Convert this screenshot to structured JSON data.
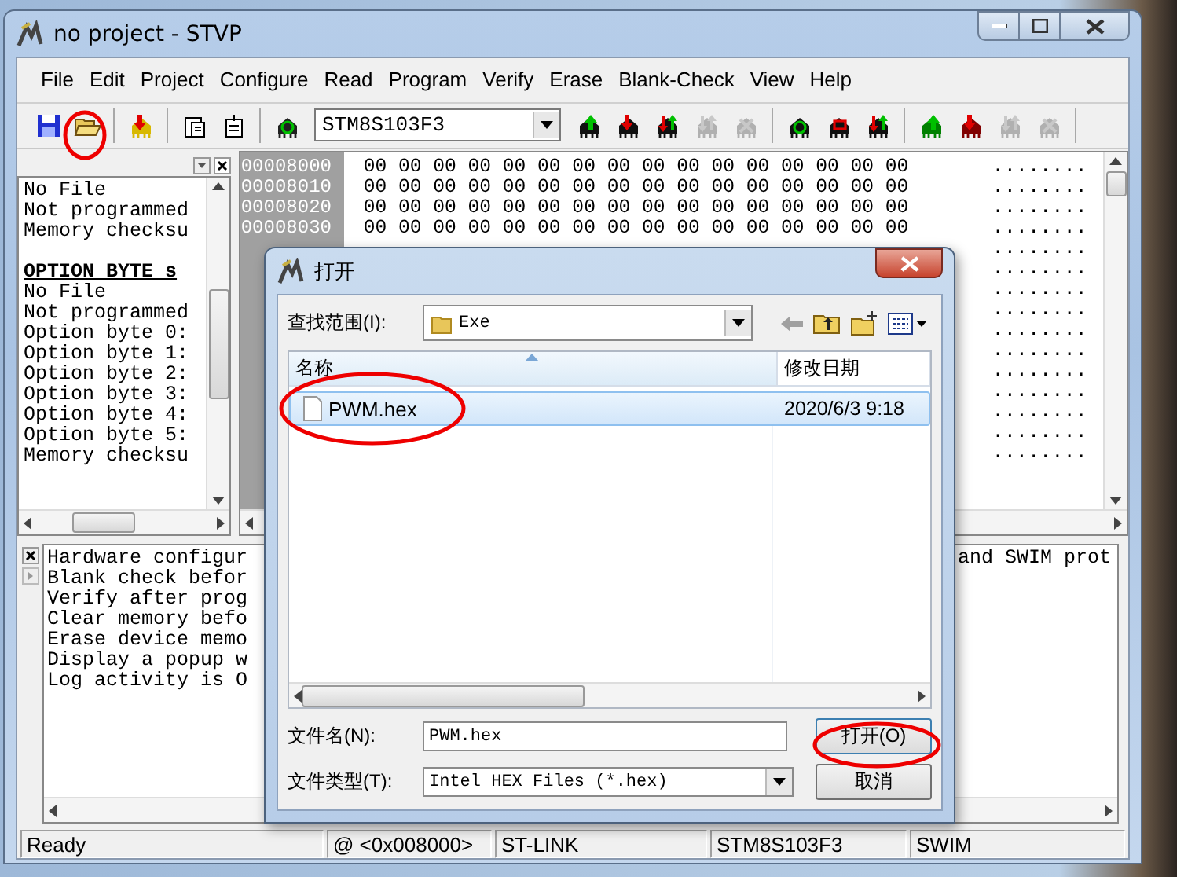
{
  "window": {
    "title": "no project - STVP"
  },
  "menu": [
    {
      "label": "File"
    },
    {
      "label": "Edit"
    },
    {
      "label": "Project"
    },
    {
      "label": "Configure"
    },
    {
      "label": "Read"
    },
    {
      "label": "Program"
    },
    {
      "label": "Verify"
    },
    {
      "label": "Erase"
    },
    {
      "label": "Blank-Check"
    },
    {
      "label": "View"
    },
    {
      "label": "Help"
    }
  ],
  "toolbar": {
    "device": "STM8S103F3",
    "chip_groups": [
      [
        {
          "kind": "up",
          "disabled": false
        },
        {
          "kind": "down",
          "disabled": false
        },
        {
          "kind": "both",
          "disabled": false
        },
        {
          "kind": "both",
          "disabled": true
        },
        {
          "kind": "cross",
          "disabled": true
        }
      ],
      [
        {
          "kind": "circle",
          "disabled": false
        },
        {
          "kind": "square",
          "disabled": false
        },
        {
          "kind": "both",
          "disabled": false
        }
      ],
      [
        {
          "kind": "up",
          "disabled": false,
          "color": "#008000"
        },
        {
          "kind": "down",
          "disabled": false,
          "color": "#800000"
        },
        {
          "kind": "both",
          "disabled": true
        },
        {
          "kind": "cross",
          "disabled": true
        }
      ]
    ]
  },
  "info_pane": {
    "lines": [
      {
        "kind": "text",
        "text": "No File"
      },
      {
        "kind": "text",
        "text": "Not programmed"
      },
      {
        "kind": "text",
        "text": "Memory checksu"
      },
      {
        "kind": "heading",
        "text": "OPTION BYTE s"
      },
      {
        "kind": "text",
        "text": "No File"
      },
      {
        "kind": "text",
        "text": "Not programmed"
      },
      {
        "kind": "text",
        "text": "Option byte 0:"
      },
      {
        "kind": "text",
        "text": "Option byte 1:"
      },
      {
        "kind": "text",
        "text": "Option byte 2:"
      },
      {
        "kind": "text",
        "text": "Option byte 3:"
      },
      {
        "kind": "text",
        "text": "Option byte 4:"
      },
      {
        "kind": "text",
        "text": "Option byte 5:"
      },
      {
        "kind": "text",
        "text": "Memory checksu"
      }
    ]
  },
  "hex_pane": {
    "rows": [
      {
        "address": "00008000",
        "bytes": "00 00 00 00 00 00 00 00 00 00 00 00 00 00 00 00",
        "ascii": "........"
      },
      {
        "address": "00008010",
        "bytes": "00 00 00 00 00 00 00 00 00 00 00 00 00 00 00 00",
        "ascii": "........"
      },
      {
        "address": "00008020",
        "bytes": "00 00 00 00 00 00 00 00 00 00 00 00 00 00 00 00",
        "ascii": "........"
      },
      {
        "address": "00008030",
        "bytes": "00 00 00 00 00 00 00 00 00 00 00 00 00 00 00 00",
        "ascii": "........"
      },
      {
        "ascii": "........"
      },
      {
        "ascii": "........"
      },
      {
        "ascii": "........"
      },
      {
        "ascii": "........"
      },
      {
        "ascii": "........"
      },
      {
        "ascii": "........"
      },
      {
        "ascii": "........"
      },
      {
        "ascii": "........"
      },
      {
        "ascii": "........"
      },
      {
        "ascii": "........"
      },
      {
        "ascii": "........"
      }
    ]
  },
  "log_pane": {
    "lines": [
      "Hardware configur",
      "Blank check befor",
      "Verify after prog",
      "Clear memory befo",
      "Erase device memo",
      "Display a popup w",
      "Log activity is O"
    ],
    "right_text": "and SWIM prot"
  },
  "status_bar": [
    {
      "text": "Ready"
    },
    {
      "text": "@ <0x008000>"
    },
    {
      "text": "ST-LINK"
    },
    {
      "text": "STM8S103F3"
    },
    {
      "text": "SWIM"
    }
  ],
  "open_dialog": {
    "title": "打开",
    "look_in_label": "查找范围(I):",
    "folder": "Exe",
    "columns": [
      {
        "label": "名称",
        "sorted": true
      },
      {
        "label": "修改日期",
        "sorted": false
      }
    ],
    "files": [
      {
        "name": "PWM.hex",
        "modified": "2020/6/3 9:18",
        "selected": true
      }
    ],
    "filename_label": "文件名(N):",
    "filename": "PWM.hex",
    "filetype_label": "文件类型(T):",
    "filetype": "Intel HEX Files (*.hex)",
    "buttons": [
      {
        "label": "打开(O)",
        "default": true
      },
      {
        "label": "取消",
        "default": false
      }
    ]
  }
}
